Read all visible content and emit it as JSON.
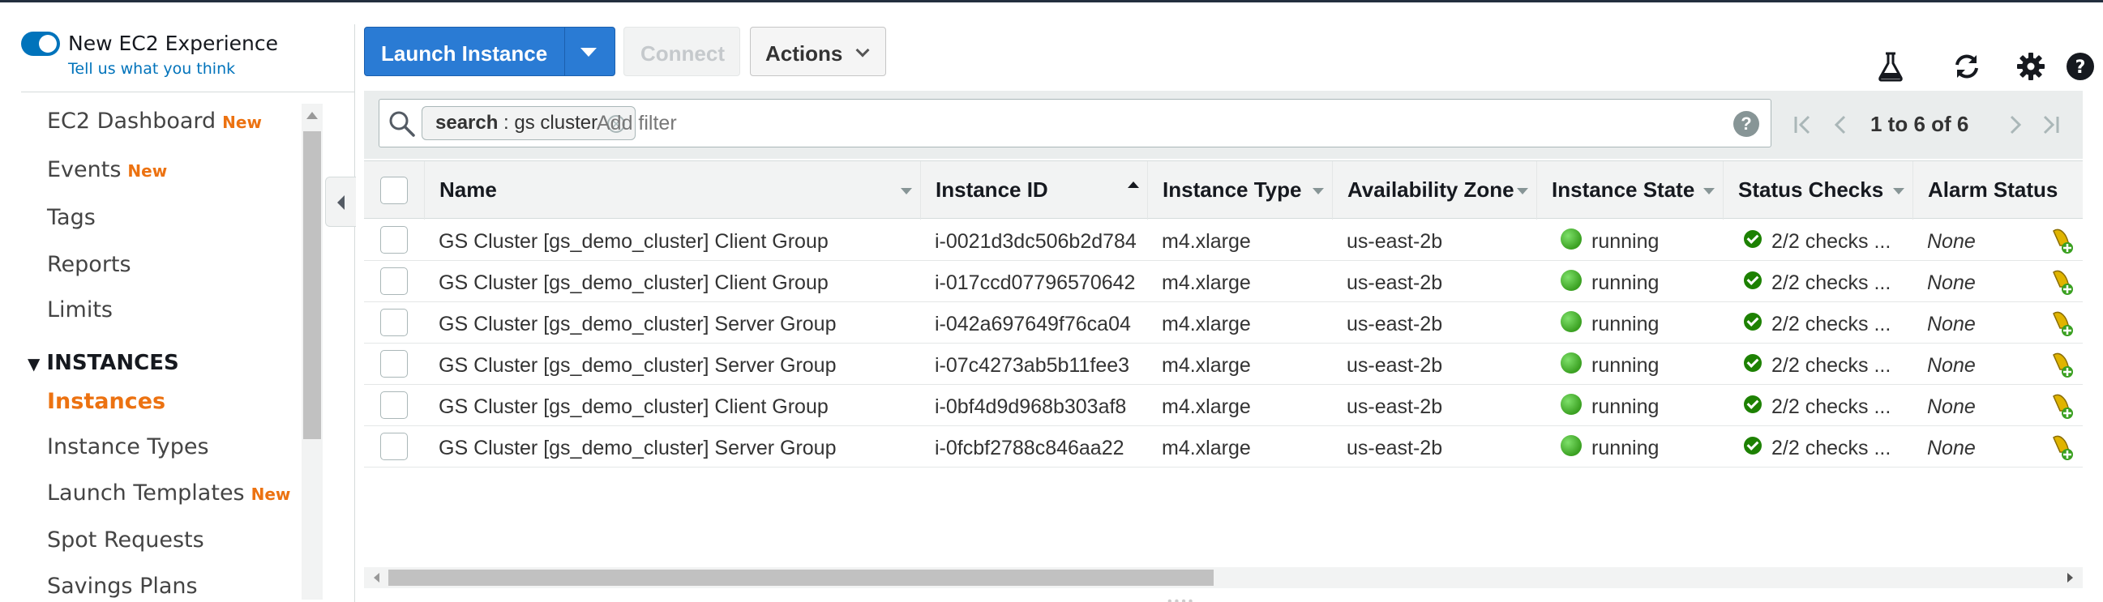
{
  "sidebar": {
    "experience_title": "New EC2 Experience",
    "experience_link": "Tell us what you think",
    "new_badge": "New",
    "items": [
      {
        "label": "EC2 Dashboard",
        "badge": "New"
      },
      {
        "label": "Events",
        "badge": "New"
      },
      {
        "label": "Tags",
        "badge": ""
      },
      {
        "label": "Reports",
        "badge": ""
      },
      {
        "label": "Limits",
        "badge": ""
      }
    ],
    "section": "INSTANCES",
    "section_items": [
      {
        "label": "Instances",
        "active": true,
        "badge": ""
      },
      {
        "label": "Instance Types",
        "badge": ""
      },
      {
        "label": "Launch Templates",
        "badge": "New"
      },
      {
        "label": "Spot Requests",
        "badge": ""
      },
      {
        "label": "Savings Plans",
        "badge": ""
      }
    ]
  },
  "toolbar": {
    "launch_label": "Launch Instance",
    "connect_label": "Connect",
    "actions_label": "Actions",
    "icons": [
      "flask-icon",
      "refresh-icon",
      "gear-icon",
      "help-icon"
    ]
  },
  "filter": {
    "token_key": "search",
    "token_sep": " : ",
    "token_value": "gs cluster",
    "placeholder": "Add filter",
    "pagination": "1 to 6 of 6"
  },
  "table": {
    "columns": [
      "Name",
      "Instance ID",
      "Instance Type",
      "Availability Zone",
      "Instance State",
      "Status Checks",
      "Alarm Status"
    ],
    "rows": [
      {
        "name": "GS Cluster [gs_demo_cluster] Client Group",
        "id": "i-0021d3dc506b2d784",
        "type": "m4.xlarge",
        "az": "us-east-2b",
        "state": "running",
        "checks": "2/2 checks ...",
        "alarm": "None"
      },
      {
        "name": "GS Cluster [gs_demo_cluster] Client Group",
        "id": "i-017ccd07796570642",
        "type": "m4.xlarge",
        "az": "us-east-2b",
        "state": "running",
        "checks": "2/2 checks ...",
        "alarm": "None"
      },
      {
        "name": "GS Cluster [gs_demo_cluster] Server Group",
        "id": "i-042a697649f76ca04",
        "type": "m4.xlarge",
        "az": "us-east-2b",
        "state": "running",
        "checks": "2/2 checks ...",
        "alarm": "None"
      },
      {
        "name": "GS Cluster [gs_demo_cluster] Server Group",
        "id": "i-07c4273ab5b11fee3",
        "type": "m4.xlarge",
        "az": "us-east-2b",
        "state": "running",
        "checks": "2/2 checks ...",
        "alarm": "None"
      },
      {
        "name": "GS Cluster [gs_demo_cluster] Client Group",
        "id": "i-0bf4d9d968b303af8",
        "type": "m4.xlarge",
        "az": "us-east-2b",
        "state": "running",
        "checks": "2/2 checks ...",
        "alarm": "None"
      },
      {
        "name": "GS Cluster [gs_demo_cluster] Server Group",
        "id": "i-0fcbf2788c846aa22",
        "type": "m4.xlarge",
        "az": "us-east-2b",
        "state": "running",
        "checks": "2/2 checks ...",
        "alarm": "None"
      }
    ]
  },
  "colors": {
    "accent": "#2a7bd4",
    "active_nav": "#ec7211",
    "running": "#3aa021",
    "check_ok": "#1d8102"
  }
}
